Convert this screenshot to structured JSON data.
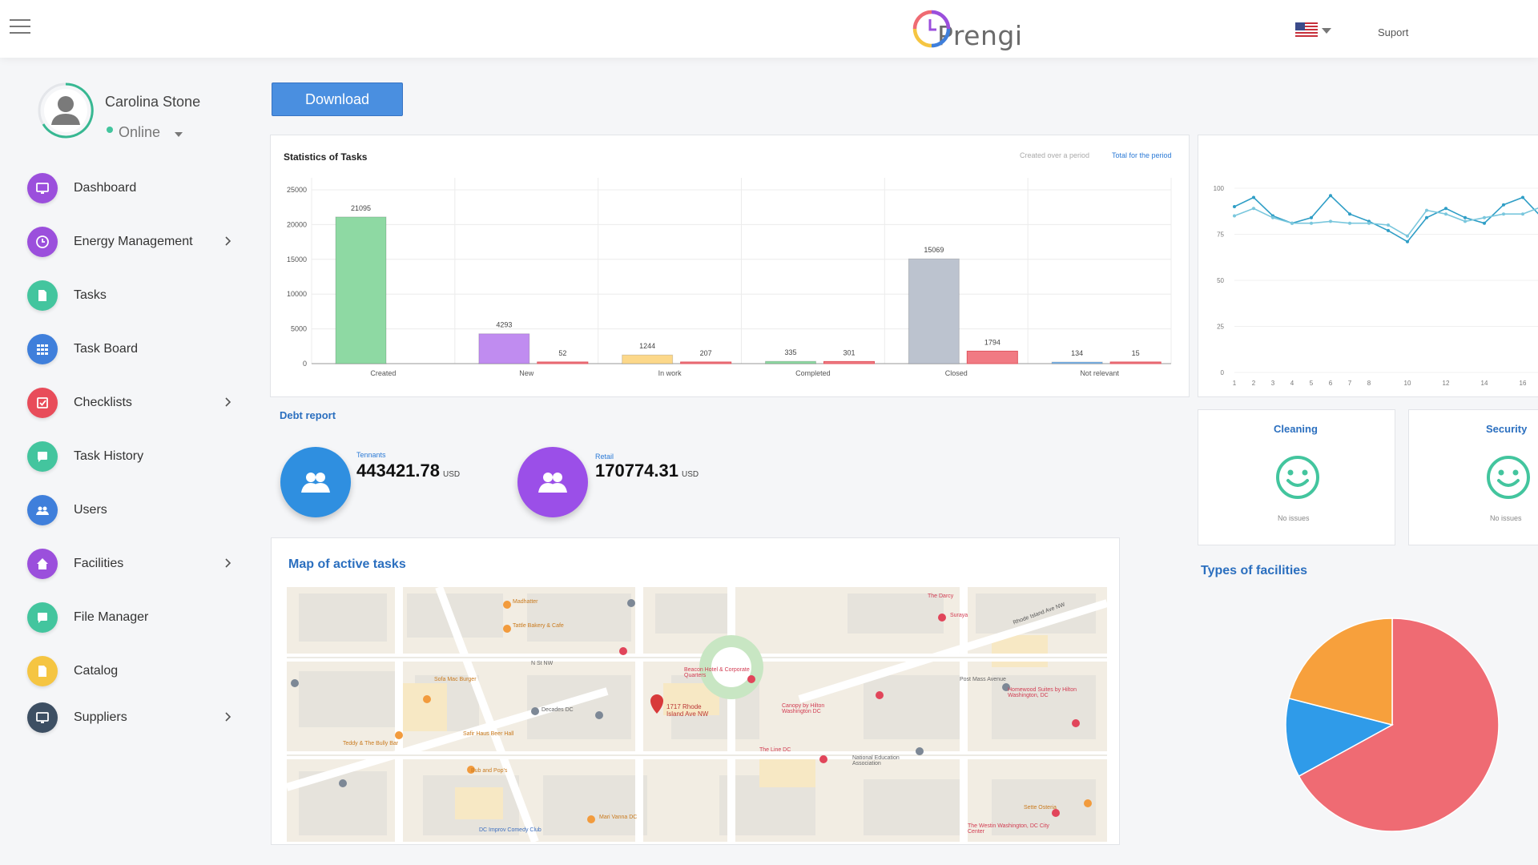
{
  "header": {
    "logo_text": "Prengi",
    "support_label": "Suport",
    "language_flag": "us-flag-icon"
  },
  "profile": {
    "name": "Carolina Stone",
    "status": "Online"
  },
  "sidebar": {
    "items": [
      {
        "label": "Dashboard",
        "icon": "monitor-icon",
        "color": "#9b4fdc",
        "chevron": false
      },
      {
        "label": "Energy Management",
        "icon": "clock-icon",
        "color": "#9b4fdc",
        "chevron": true
      },
      {
        "label": "Tasks",
        "icon": "document-icon",
        "color": "#43c59e",
        "chevron": false
      },
      {
        "label": "Task Board",
        "icon": "grid-icon",
        "color": "#3f7fdb",
        "chevron": false
      },
      {
        "label": "Checklists",
        "icon": "checkbox-icon",
        "color": "#e84c5a",
        "chevron": true
      },
      {
        "label": "Task History",
        "icon": "chat-icon",
        "color": "#43c59e",
        "chevron": false
      },
      {
        "label": "Users",
        "icon": "users-icon",
        "color": "#3f7fdb",
        "chevron": false
      },
      {
        "label": "Facilities",
        "icon": "home-icon",
        "color": "#9b4fdc",
        "chevron": true
      },
      {
        "label": "File Manager",
        "icon": "chat-icon",
        "color": "#43c59e",
        "chevron": false
      },
      {
        "label": "Catalog",
        "icon": "document-icon",
        "color": "#f5c542",
        "chevron": false
      },
      {
        "label": "Suppliers",
        "icon": "monitor-icon",
        "color": "#3d4f63",
        "chevron": true
      }
    ]
  },
  "main": {
    "download_label": "Download",
    "stats": {
      "title": "Statistics of Tasks",
      "toggle_created": "Created over a period",
      "toggle_total": "Total for the period"
    },
    "debt": {
      "title": "Debt report",
      "items": [
        {
          "label": "Tennants",
          "value": "443421.78",
          "unit": "USD",
          "color": "#2f8fe0"
        },
        {
          "label": "Retail",
          "value": "170774.31",
          "unit": "USD",
          "color": "#9b4fe8"
        }
      ]
    },
    "map": {
      "title": "Map of active tasks",
      "labels": [
        "1717 Rhode Island Ave NW",
        "N St NW",
        "Madhatter",
        "Tattle Bakery & Cafe",
        "Beacon Hotel & Corporate Quarters",
        "Canopy by Hilton Washington DC",
        "The Line DC",
        "National Education Association",
        "Post Mass Avenue",
        "Homewood Suites by Hilton Washington, DC",
        "Sette Osteria",
        "The Westin Washington, DC City Center",
        "DC Improv Comedy Club",
        "Mari Vanna DC",
        "Decades DC",
        "Suraya",
        "Rhode Island Ave NW",
        "The Darcy",
        "Safir Haus Beer Hall",
        "Sofa Mac Burger",
        "Teddy & The Bully Bar",
        "Bub and Pop's"
      ]
    },
    "status_cards": [
      {
        "title": "Cleaning",
        "sub": "No issues"
      },
      {
        "title": "Security",
        "sub": "No issues"
      }
    ],
    "types_title": "Types of facilities"
  },
  "chart_data": [
    {
      "type": "bar",
      "title": "Statistics of Tasks",
      "categories": [
        "Created",
        "New",
        "In work",
        "Completed",
        "Closed",
        "Not relevant"
      ],
      "series": [
        {
          "values": [
            21095,
            4293,
            1244,
            335,
            15069,
            134
          ],
          "colors": [
            "#8ed9a3",
            "#c08cf0",
            "#fcd88a",
            "#8ed9a3",
            "#bcc3cf",
            "#7db8ee"
          ]
        },
        {
          "values": [
            0,
            52,
            207,
            301,
            1794,
            15
          ],
          "colors": [
            "#f17a83",
            "#f17a83",
            "#f17a83",
            "#f17a83",
            "#f17a83",
            "#f17a83"
          ]
        }
      ],
      "yticks": [
        0,
        5000,
        10000,
        15000,
        20000,
        25000
      ],
      "ylim": [
        0,
        25000
      ]
    },
    {
      "type": "line",
      "title": "",
      "yticks": [
        0,
        25,
        50,
        75,
        100
      ],
      "xticks": [
        "1",
        "2",
        "3",
        "4",
        "5",
        "6",
        "7",
        "8",
        "10",
        "12",
        "14",
        "16"
      ],
      "ylim": [
        0,
        100
      ],
      "series": [
        {
          "color": "#2f9ec6",
          "x": [
            1,
            2,
            3,
            4,
            5,
            6,
            7,
            8,
            9,
            10,
            11,
            12,
            13,
            14,
            15,
            16,
            17
          ],
          "y": [
            90,
            95,
            85,
            81,
            84,
            96,
            86,
            82,
            77,
            71,
            84,
            89,
            84,
            81,
            91,
            95,
            84
          ]
        },
        {
          "color": "#7ac7dd",
          "x": [
            1,
            2,
            3,
            4,
            5,
            6,
            7,
            8,
            9,
            10,
            11,
            12,
            13,
            14,
            15,
            16,
            17
          ],
          "y": [
            85,
            89,
            84,
            81,
            81,
            82,
            81,
            81,
            80,
            74,
            88,
            86,
            82,
            84,
            86,
            86,
            90
          ]
        }
      ]
    },
    {
      "type": "pie",
      "title": "Types of facilities",
      "slices": [
        {
          "value": 67,
          "color": "#ef6b73"
        },
        {
          "value": 12,
          "color": "#2f9be9"
        },
        {
          "value": 21,
          "color": "#f7a03c"
        }
      ]
    }
  ]
}
